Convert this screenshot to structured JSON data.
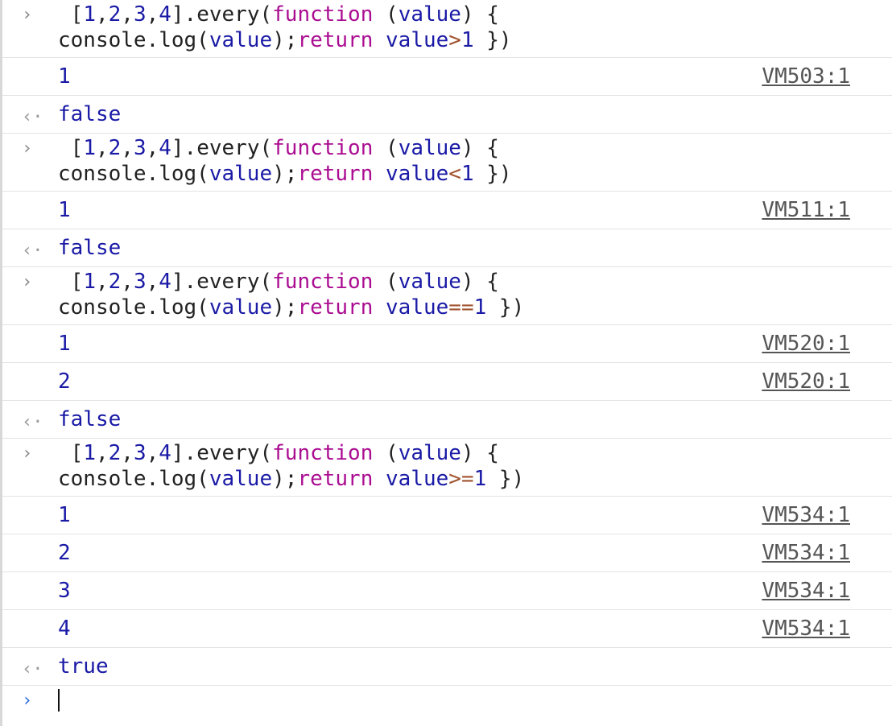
{
  "console": {
    "entries": [
      {
        "type": "input",
        "line1": {
          "lead": " [",
          "n1": "1",
          "s1": ",",
          "n2": "2",
          "s2": ",",
          "n3": "3",
          "s3": ",",
          "n4": "4",
          "after": "].every(",
          "kw": "function",
          "paren": " (",
          "param": "value",
          "close": ") {"
        },
        "line2": {
          "a": "console.log(",
          "b": "value",
          "c": ");",
          "kw": "return",
          "sp": " ",
          "id": "value",
          "op": ">",
          "num": "1",
          "end": " })"
        }
      },
      {
        "type": "log",
        "value": "1",
        "source": "VM503:1"
      },
      {
        "type": "result",
        "value": "false"
      },
      {
        "type": "input",
        "line1": {
          "lead": " [",
          "n1": "1",
          "s1": ",",
          "n2": "2",
          "s2": ",",
          "n3": "3",
          "s3": ",",
          "n4": "4",
          "after": "].every(",
          "kw": "function",
          "paren": " (",
          "param": "value",
          "close": ") {"
        },
        "line2": {
          "a": "console.log(",
          "b": "value",
          "c": ");",
          "kw": "return",
          "sp": " ",
          "id": "value",
          "op": "<",
          "num": "1",
          "end": " })"
        }
      },
      {
        "type": "log",
        "value": "1",
        "source": "VM511:1"
      },
      {
        "type": "result",
        "value": "false"
      },
      {
        "type": "input",
        "line1": {
          "lead": " [",
          "n1": "1",
          "s1": ",",
          "n2": "2",
          "s2": ",",
          "n3": "3",
          "s3": ",",
          "n4": "4",
          "after": "].every(",
          "kw": "function",
          "paren": " (",
          "param": "value",
          "close": ") {"
        },
        "line2": {
          "a": "console.log(",
          "b": "value",
          "c": ");",
          "kw": "return",
          "sp": " ",
          "id": "value",
          "op": "==",
          "num": "1",
          "end": " })"
        }
      },
      {
        "type": "log",
        "value": "1",
        "source": "VM520:1"
      },
      {
        "type": "log",
        "value": "2",
        "source": "VM520:1"
      },
      {
        "type": "result",
        "value": "false"
      },
      {
        "type": "input",
        "line1": {
          "lead": " [",
          "n1": "1",
          "s1": ",",
          "n2": "2",
          "s2": ",",
          "n3": "3",
          "s3": ",",
          "n4": "4",
          "after": "].every(",
          "kw": "function",
          "paren": " (",
          "param": "value",
          "close": ") {"
        },
        "line2": {
          "a": "console.log(",
          "b": "value",
          "c": ");",
          "kw": "return",
          "sp": " ",
          "id": "value",
          "op": ">=",
          "num": "1",
          "end": " })"
        }
      },
      {
        "type": "log",
        "value": "1",
        "source": "VM534:1"
      },
      {
        "type": "log",
        "value": "2",
        "source": "VM534:1"
      },
      {
        "type": "log",
        "value": "3",
        "source": "VM534:1"
      },
      {
        "type": "log",
        "value": "4",
        "source": "VM534:1"
      },
      {
        "type": "result",
        "value": "true"
      }
    ],
    "icons": {
      "input": "chevron-right-icon",
      "result": "arrow-left-return-icon",
      "prompt": "chevron-right-icon"
    },
    "colors": {
      "number": "#1a1aa6",
      "keyword": "#aa0d91",
      "operator": "#a0522d",
      "prompt": "#2b6cdf"
    }
  }
}
